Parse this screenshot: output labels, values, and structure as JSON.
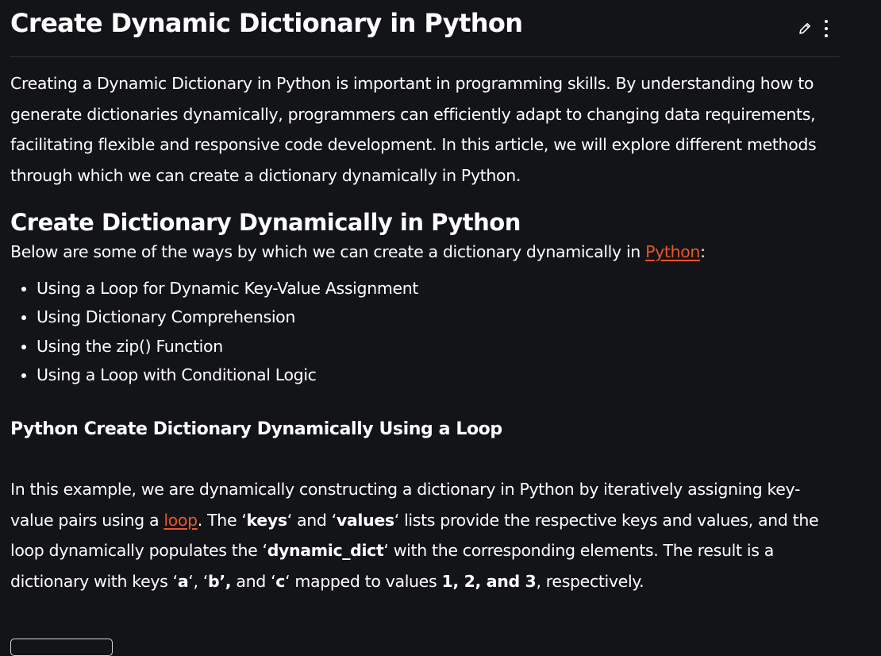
{
  "article": {
    "title": "Create Dynamic Dictionary in Python",
    "actions": {
      "edit_icon": "pencil-icon",
      "more_icon": "kebab-menu-icon"
    },
    "intro": "Creating a Dynamic Dictionary in Python is important in programming skills. By understanding how to generate dictionaries dynamically, programmers can efficiently adapt to changing data requirements, facilitating flexible and responsive code development. In this article, we will explore different methods through which we can create a dictionary dynamically in Python.",
    "section": {
      "heading": "Create Dictionary Dynamically in Python",
      "lead_before": "Below are some of the ways by which we can create a dictionary dynamically in ",
      "lead_link": "Python",
      "lead_after": ":",
      "methods": [
        "Using a Loop for Dynamic Key-Value Assignment",
        "Using Dictionary Comprehension",
        "Using the zip() Function",
        "Using a Loop with Conditional Logic"
      ]
    },
    "subsection": {
      "heading": "Python Create Dictionary Dynamically Using a Loop",
      "p1": "In this example, we are dynamically constructing a dictionary in Python by iteratively assigning key-value pairs using a ",
      "p1_link": "loop",
      "p2": ". The ",
      "q_open": "‘",
      "q_close": "‘",
      "q_close_b": "’",
      "keys": "keys",
      "p3": " and ",
      "values": "values",
      "p4": " lists provide the respective keys and values, and the loop dynamically populates the ",
      "dynamic_dict": "dynamic_dict",
      "p5": " with the corresponding elements. The result is a dictionary with keys ",
      "key_a": "a",
      "sep_comma": ", ",
      "key_b": "b",
      "p6": " and ",
      "key_c": "c",
      "p7": " mapped to values ",
      "vals": "1, 2, and 3",
      "p8": ", respectively."
    }
  },
  "colors": {
    "background": "#131417",
    "text": "#ffffff",
    "link": "#e8562a",
    "divider": "#2e3035"
  }
}
